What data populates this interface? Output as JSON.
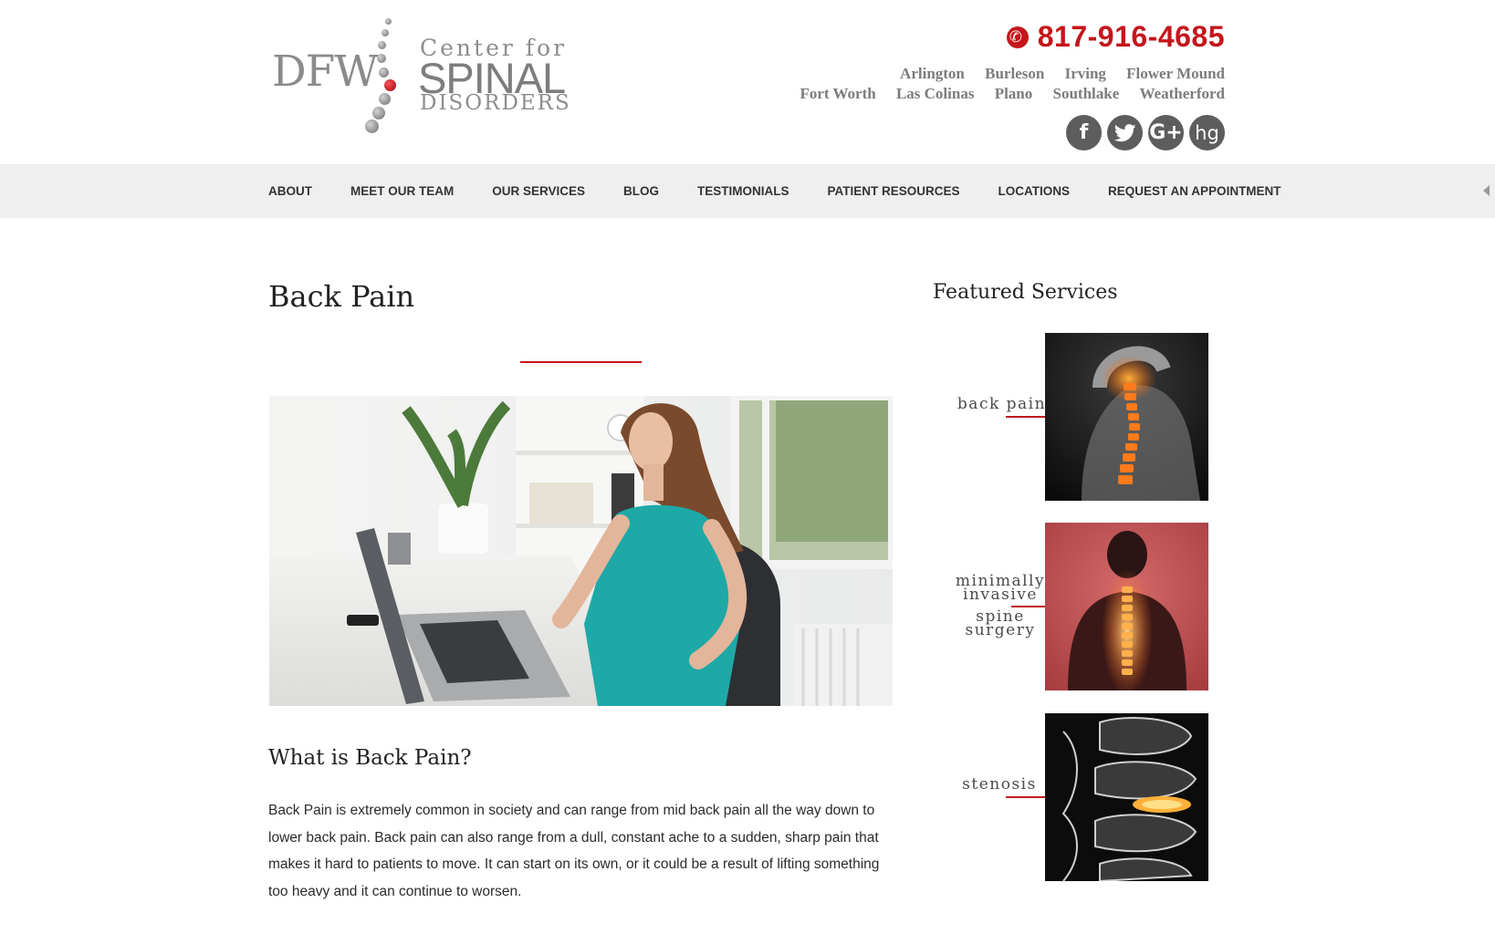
{
  "logo": {
    "dfw": "DFW",
    "center_for": "Center for",
    "spinal": "SPINAL",
    "disorders": "DISORDERS"
  },
  "header": {
    "phone": "817-916-4685",
    "cities_row1": [
      "Arlington",
      "Burleson",
      "Irving",
      "Flower Mound"
    ],
    "cities_row2": [
      "Fort Worth",
      "Las Colinas",
      "Plano",
      "Southlake",
      "Weatherford"
    ],
    "social": [
      {
        "icon": "facebook-icon",
        "glyph": "f"
      },
      {
        "icon": "twitter-icon",
        "glyph": "🐦"
      },
      {
        "icon": "google-plus-icon",
        "glyph": "G+"
      },
      {
        "icon": "healthgrades-icon",
        "glyph": "hg"
      }
    ]
  },
  "nav": {
    "items": [
      "ABOUT",
      "MEET OUR TEAM",
      "OUR SERVICES",
      "BLOG",
      "TESTIMONIALS",
      "PATIENT RESOURCES",
      "LOCATIONS",
      "REQUEST AN APPOINTMENT"
    ]
  },
  "main": {
    "title": "Back Pain",
    "section_title": "What is Back Pain?",
    "body": "Back Pain is extremely common in society and can range from mid back pain all the way down to lower back pain. Back pain can also range from a dull, constant ache to a sudden, sharp pain that makes it hard to patients to move. It can start on its own, or it could be a result of lifting something too heavy and it can continue to worsen."
  },
  "sidebar": {
    "title": "Featured Services",
    "cards": [
      {
        "lines": [
          "back pain"
        ]
      },
      {
        "lines": [
          "minimally",
          "invasive",
          "spine",
          "surgery"
        ]
      },
      {
        "lines": [
          "stenosis"
        ]
      }
    ]
  },
  "colors": {
    "accent": "#c4161c",
    "nav_bg": "#efefef",
    "logo_gray": "#8b8b8b"
  }
}
